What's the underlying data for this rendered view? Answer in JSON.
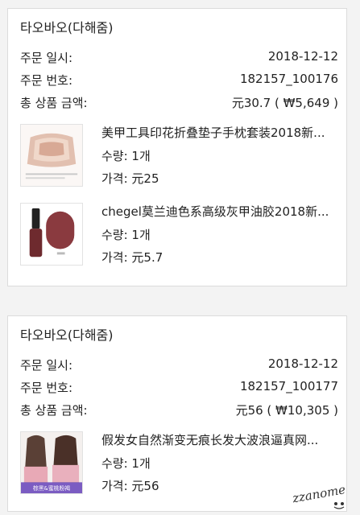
{
  "orders": [
    {
      "store": "타오바오(다해줌)",
      "date_label": "주문 일시:",
      "date": "2018-12-12",
      "number_label": "주문 번호:",
      "number": "182157_100176",
      "total_label": "총 상품 금액:",
      "total": "元30.7 ( ₩5,649 )",
      "items": [
        {
          "name": "美甲工具印花折叠垫子手枕套装2018新...",
          "qty": "수량: 1개",
          "price": "가격: 元25",
          "thumb_icon": "nail-hand-pillow-icon"
        },
        {
          "name": "chegel莫兰迪色系高级灰甲油胶2018新...",
          "qty": "수량: 1개",
          "price": "가격: 元5.7",
          "thumb_icon": "gel-polish-bottle-icon"
        }
      ]
    },
    {
      "store": "타오바오(다해줌)",
      "date_label": "주문 일시:",
      "date": "2018-12-12",
      "number_label": "주문 번호:",
      "number": "182157_100177",
      "total_label": "총 상품 금액:",
      "total": "元56 ( ₩10,305 )",
      "items": [
        {
          "name": "假发女自然渐变无痕长发大波浪逼真网...",
          "qty": "수량: 1개",
          "price": "가격: 元56",
          "thumb_icon": "long-wig-icon",
          "thumb_caption": "棕黑&蜜桃粉褐"
        }
      ]
    }
  ],
  "watermark": "zzanome",
  "colors": {
    "background": "#f3f3f3",
    "card": "#ffffff",
    "border": "#dcdcdc",
    "wig_caption_bar": "#7b5cc2"
  }
}
